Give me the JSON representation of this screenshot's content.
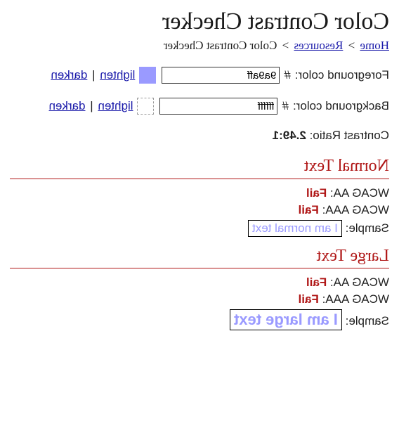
{
  "page_title": "Color Contrast Checker",
  "breadcrumb": {
    "home": "Home",
    "resources": "Resources",
    "current": "Color Contrast Checker",
    "sep": ">"
  },
  "foreground": {
    "label": "Foreground color:",
    "hash": "#",
    "value": "9a9aff",
    "lighten": "lighten",
    "darken": "darken",
    "pipe": "|"
  },
  "background": {
    "label": "Background color:",
    "hash": "#",
    "value": "ffffff",
    "lighten": "lighten",
    "darken": "darken",
    "pipe": "|"
  },
  "ratio": {
    "label": "Contrast Ratio: ",
    "value": "2.49:1"
  },
  "normal": {
    "heading": "Normal Text",
    "aa_label": "WCAG AA: ",
    "aa_result": "Fail",
    "aaa_label": "WCAG AAA: ",
    "aaa_result": "Fail",
    "sample_label": "Sample: ",
    "sample_text": "I am normal text"
  },
  "large": {
    "heading": "Large Text",
    "aa_label": "WCAG AA: ",
    "aa_result": "Fail",
    "aaa_label": "WCAG AAA: ",
    "aaa_result": "Fail",
    "sample_label": "Sample: ",
    "sample_text": "I am large text"
  }
}
